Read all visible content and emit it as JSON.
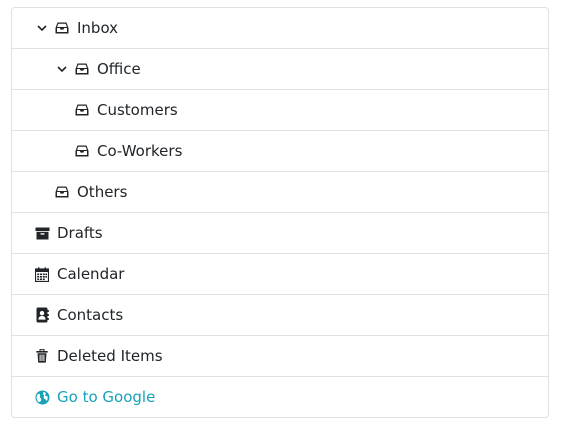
{
  "tree": {
    "items": [
      {
        "label": "Inbox",
        "icon": "inbox-icon",
        "expanded": true
      },
      {
        "label": "Office",
        "icon": "inbox-icon",
        "expanded": true
      },
      {
        "label": "Customers",
        "icon": "inbox-icon"
      },
      {
        "label": "Co-Workers",
        "icon": "inbox-icon"
      },
      {
        "label": "Others",
        "icon": "inbox-icon"
      },
      {
        "label": "Drafts",
        "icon": "archive-icon"
      },
      {
        "label": "Calendar",
        "icon": "calendar-icon"
      },
      {
        "label": "Contacts",
        "icon": "address-book-icon"
      },
      {
        "label": "Deleted Items",
        "icon": "trash-icon"
      },
      {
        "label": "Go to Google",
        "icon": "globe-icon",
        "link": true
      }
    ]
  },
  "colors": {
    "text": "#212529",
    "border": "#dee2e6",
    "link": "#17a2b8"
  }
}
